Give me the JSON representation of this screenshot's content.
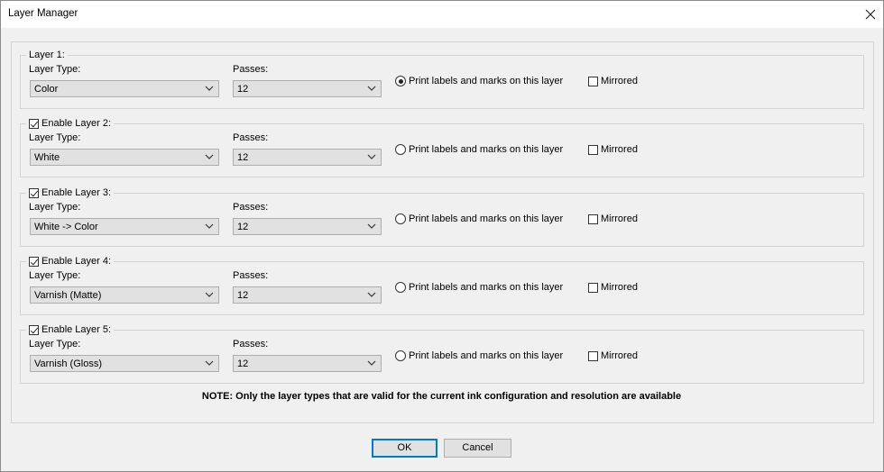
{
  "window": {
    "title": "Layer Manager"
  },
  "layers": [
    {
      "legend": "Layer 1:",
      "has_enable_checkbox": false,
      "enabled": true,
      "type_label": "Layer Type:",
      "type_value": "Color",
      "passes_label": "Passes:",
      "passes_value": "12",
      "print_label": "Print labels and marks on this layer",
      "print_selected": true,
      "mirrored_label": "Mirrored",
      "mirrored": false
    },
    {
      "legend": "Enable Layer 2:",
      "has_enable_checkbox": true,
      "enabled": true,
      "type_label": "Layer Type:",
      "type_value": "White",
      "passes_label": "Passes:",
      "passes_value": "12",
      "print_label": "Print labels and marks on this layer",
      "print_selected": false,
      "mirrored_label": "Mirrored",
      "mirrored": false
    },
    {
      "legend": "Enable Layer 3:",
      "has_enable_checkbox": true,
      "enabled": true,
      "type_label": "Layer Type:",
      "type_value": "White -> Color",
      "passes_label": "Passes:",
      "passes_value": "12",
      "print_label": "Print labels and marks on this layer",
      "print_selected": false,
      "mirrored_label": "Mirrored",
      "mirrored": false
    },
    {
      "legend": "Enable Layer 4:",
      "has_enable_checkbox": true,
      "enabled": true,
      "type_label": "Layer Type:",
      "type_value": "Varnish (Matte)",
      "passes_label": "Passes:",
      "passes_value": "12",
      "print_label": "Print labels and marks on this layer",
      "print_selected": false,
      "mirrored_label": "Mirrored",
      "mirrored": false
    },
    {
      "legend": "Enable Layer 5:",
      "has_enable_checkbox": true,
      "enabled": true,
      "type_label": "Layer Type:",
      "type_value": "Varnish (Gloss)",
      "passes_label": "Passes:",
      "passes_value": "12",
      "print_label": "Print labels and marks on this layer",
      "print_selected": false,
      "mirrored_label": "Mirrored",
      "mirrored": false
    }
  ],
  "note": "NOTE: Only the layer types that are valid for the current ink configuration and resolution are available",
  "buttons": {
    "ok": "OK",
    "cancel": "Cancel"
  },
  "icons": {
    "close": "close-icon",
    "dropdown": "chevron-down-icon"
  },
  "colors": {
    "accent": "#0078d7",
    "window_bg": "#f0f0f0",
    "control_bg": "#e1e1e1"
  }
}
